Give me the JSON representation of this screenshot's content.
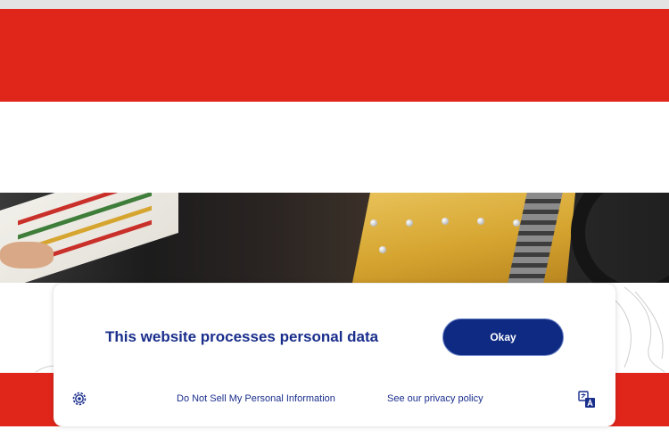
{
  "consent_banner": {
    "title": "This website processes personal data",
    "okay_label": "Okay",
    "do_not_sell_label": "Do Not Sell My Personal Information",
    "privacy_policy_label": "See our privacy policy",
    "settings_icon": "gear-icon",
    "language_icon": "translate-icon"
  },
  "colors": {
    "brand_red": "#e0251b",
    "banner_text": "#1a2e8c",
    "okay_button": "#0e2a82",
    "okay_button_border": "#6f86c9"
  }
}
